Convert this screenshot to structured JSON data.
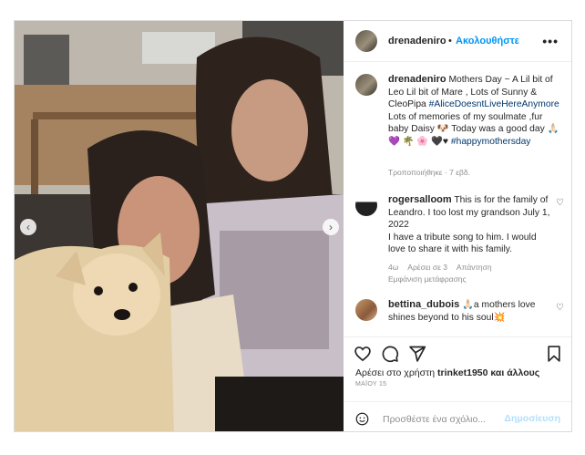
{
  "header": {
    "username": "drenadeniro",
    "separator": "•",
    "follow_label": "Ακολουθήστε",
    "more_icon": "more-horizontal-icon"
  },
  "caption": {
    "username": "drenadeniro",
    "text_part1": "Mothers Day ~ A Lil bit of Leo Lil bit of Mare , Lots of Sunny & CleoPipa",
    "hashtag1": "#AliceDoesntLiveHereAnymore",
    "text_part2": "Lots of memories of my soulmate ,fur baby Daisy 🐶 Today was a good day 🙏🏻 💜 🌴 🌸 🖤♥",
    "hashtag2": "#happymothersday",
    "edited": "Τροποποιήθηκε · 7 εβδ."
  },
  "comments": [
    {
      "username": "rogersalloom",
      "text_line1": "This is for the family of Leandro. I too lost my grandson July 1, 2022",
      "text_line2": "I have a tribute song to him. I would love to share it with his family.",
      "age": "4ω",
      "likes": "Αρέσει σε 3",
      "reply": "Απάντηση",
      "translate": "Εμφάνιση μετάφρασης"
    },
    {
      "username": "bettina_dubois",
      "text": "🙏🏻a mothers love shines beyond to his soul💥"
    }
  ],
  "actions": {
    "likes_prefix": "Αρέσει στο χρήστη",
    "likes_user": "trinket1950",
    "likes_suffix": "και άλλους",
    "date": "ΜΑΪΟΥ 15"
  },
  "add_comment": {
    "placeholder": "Προσθέστε ένα σχόλιο...",
    "post_label": "Δημοσίευση"
  },
  "colors": {
    "link_blue": "#0095f6",
    "hashtag_blue": "#00376b",
    "muted": "#8e8e8e",
    "border": "#dbdbdb"
  }
}
